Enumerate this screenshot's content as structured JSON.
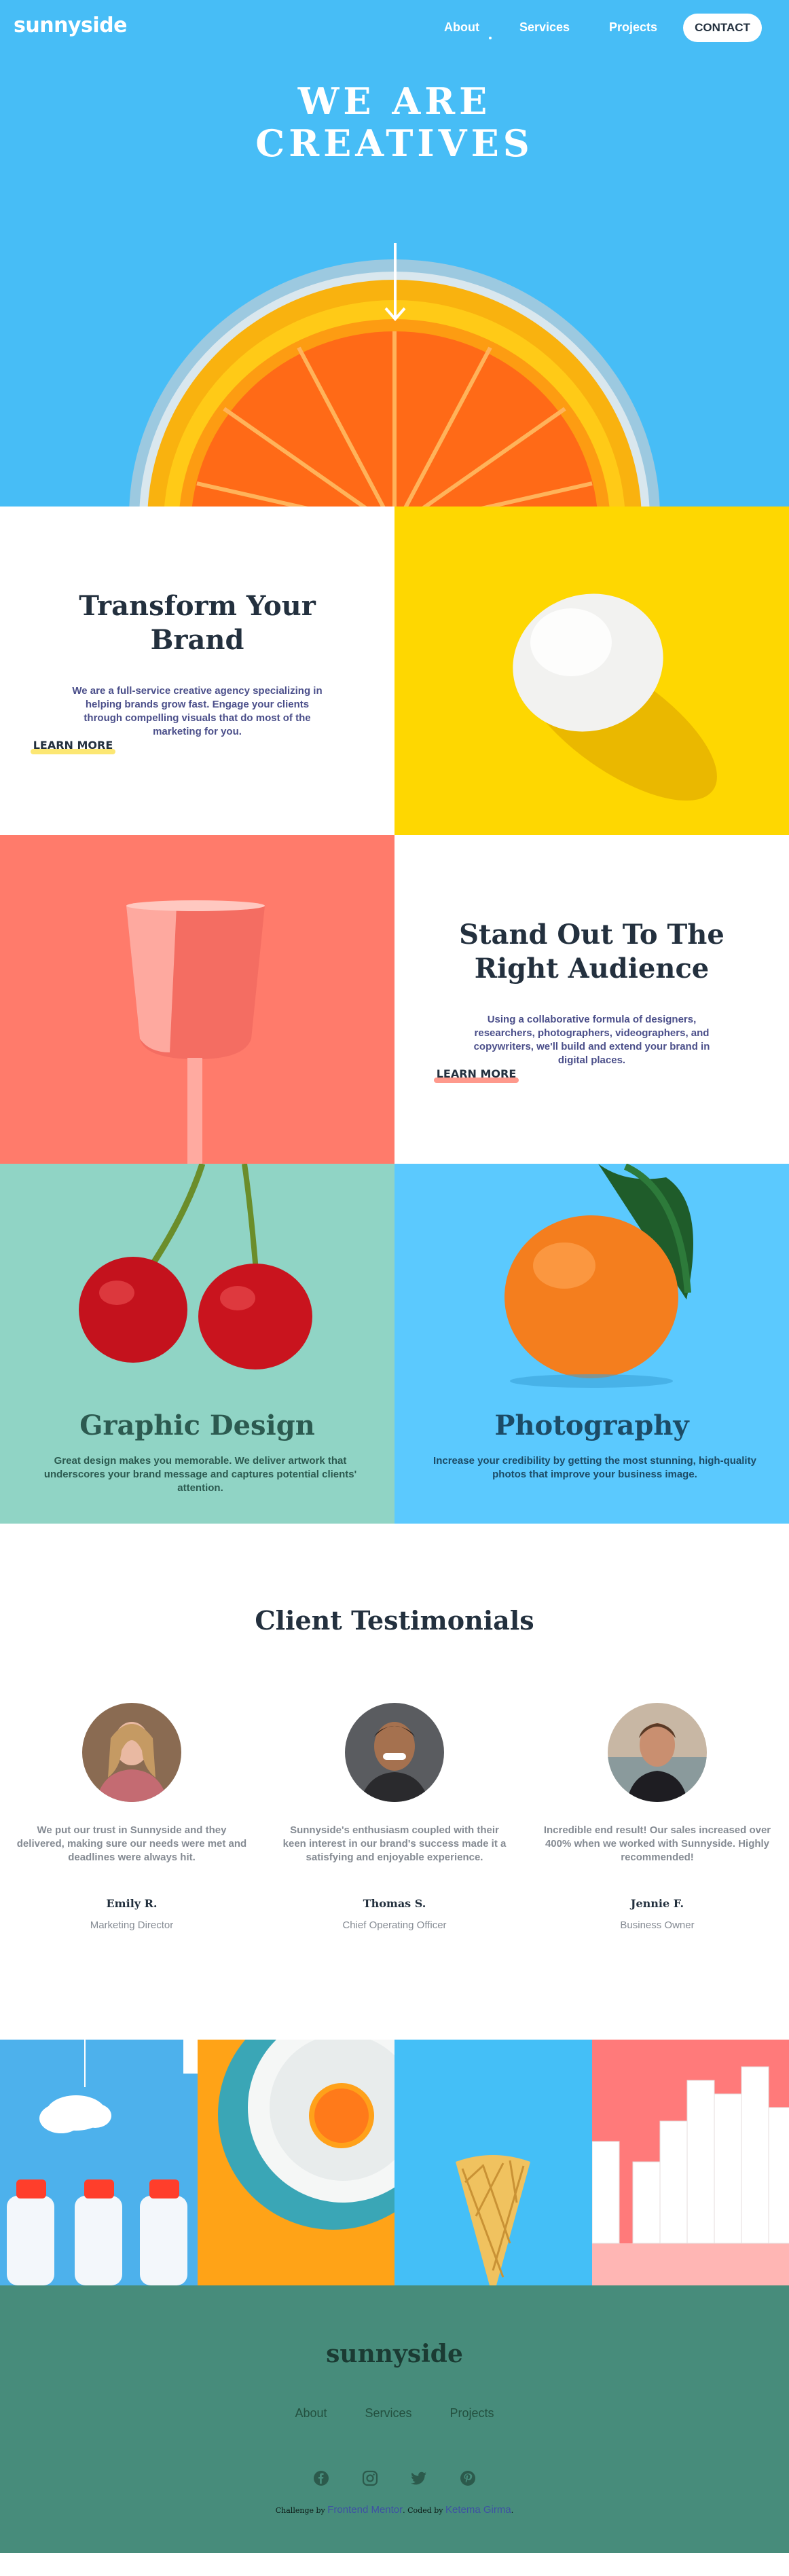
{
  "header": {
    "logo": "sunnyside",
    "nav": {
      "about": "About",
      "services": "Services",
      "projects": "Projects",
      "contact": "CONTACT"
    },
    "hero_title_line1": "WE ARE",
    "hero_title_line2": "CREATIVES"
  },
  "features": [
    {
      "title": "Transform Your Brand",
      "body": "We are a full-service creative agency specializing in helping brands grow fast. Engage your clients through compelling visuals that do most of the marketing for you.",
      "link": "LEARN MORE",
      "accent": "#fad400"
    },
    {
      "title": "Stand Out To The Right Audience",
      "body": "Using a collaborative formula of designers, researchers, photographers, videographers, and copywriters, we'll build and extend your brand in digital places.",
      "link": "LEARN MORE",
      "accent": "#fe7766"
    }
  ],
  "services": [
    {
      "title": "Graphic Design",
      "body": "Great design makes you memorable. We deliver artwork that underscores your brand message and captures potential clients' attention.",
      "color": "#2c5a50"
    },
    {
      "title": "Photography",
      "body": "Increase your credibility by getting the most stunning, high-quality photos that improve your business image.",
      "color": "#1c4b66"
    }
  ],
  "testimonials": {
    "title": "Client Testimonials",
    "items": [
      {
        "quote": "We put our trust in Sunnyside and they delivered, making sure our needs were met and deadlines were always hit.",
        "name": "Emily R.",
        "role": "Marketing Director"
      },
      {
        "quote": "Sunnyside's enthusiasm coupled with their keen interest in our brand's success made it a satisfying and enjoyable experience.",
        "name": "Thomas S.",
        "role": "Chief Operating Officer"
      },
      {
        "quote": "Incredible end result! Our sales increased over 400% when we worked with Sunnyside. Highly recommended!",
        "name": "Jennie F.",
        "role": "Business Owner"
      }
    ]
  },
  "footer": {
    "logo": "sunnyside",
    "links": {
      "about": "About",
      "services": "Services",
      "projects": "Projects"
    },
    "socials": [
      "facebook-icon",
      "instagram-icon",
      "twitter-icon",
      "pinterest-icon"
    ],
    "attribution": {
      "challenge_prefix": "Challenge by",
      "challenge_link": "Frontend Mentor",
      "coded_prefix": "Coded by",
      "coded_link": "Ketema Girma"
    }
  },
  "colors": {
    "hero_bg": "#47bdf6",
    "yellow": "#fad400",
    "coral": "#fe7766",
    "mint": "#94d5c7",
    "sky": "#5ccaff",
    "footer": "#478c7b"
  }
}
